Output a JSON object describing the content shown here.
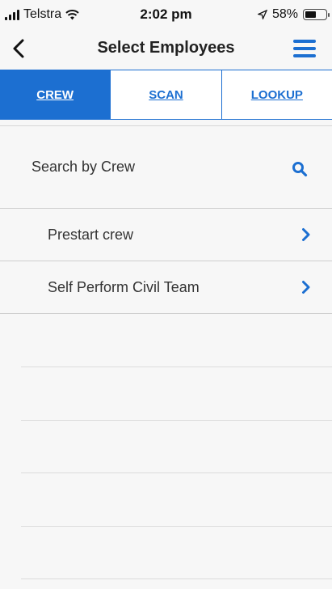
{
  "status_bar": {
    "carrier": "Telstra",
    "time": "2:02 pm",
    "battery_text": "58%",
    "battery_level": 0.58
  },
  "nav": {
    "title": "Select Employees",
    "accent_color": "#1c6fd1"
  },
  "tabs": [
    {
      "label": "CREW",
      "active": true
    },
    {
      "label": "SCAN",
      "active": false
    },
    {
      "label": "LOOKUP",
      "active": false
    }
  ],
  "search": {
    "label": "Search by Crew",
    "icon": "search-icon"
  },
  "crews": [
    {
      "label": "Prestart crew"
    },
    {
      "label": "Self Perform Civil Team"
    }
  ]
}
